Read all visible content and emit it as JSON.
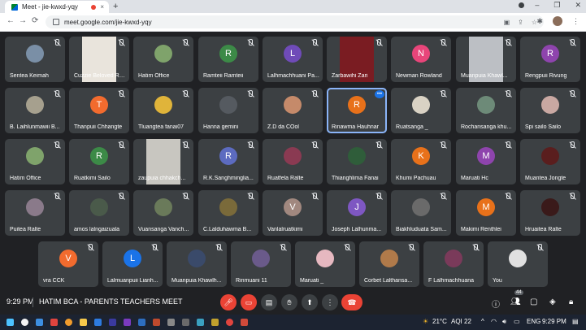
{
  "browser": {
    "tab_title": "Meet - jie-kwxd-yqy",
    "tab_close": "×",
    "new_tab": "+",
    "url": "meet.google.com/jie-kwxd-yqy",
    "back": "←",
    "forward": "→",
    "reload": "⟳",
    "window_buttons": [
      "–",
      "❐",
      "✕"
    ],
    "toolbar_icons": [
      "✱",
      "⋮"
    ]
  },
  "participants": [
    {
      "name": "Sentea Keimah",
      "type": "photo",
      "color": "#7a8fa6"
    },
    {
      "name": "Cuzzie Beloved Ranker",
      "type": "video",
      "color": "#e9e4dc"
    },
    {
      "name": "Hatim Office",
      "type": "photo",
      "color": "#7fa36b"
    },
    {
      "name": "Ramteii Ramteii",
      "type": "initial",
      "initial": "R",
      "color": "#3c8a47"
    },
    {
      "name": "Lalhmachhuani Pa...",
      "type": "initial",
      "initial": "L",
      "color": "#6f4bb8"
    },
    {
      "name": "Zarbawihi Zari",
      "type": "video",
      "color": "#7a1c22"
    },
    {
      "name": "Newman Rowland",
      "type": "initial",
      "initial": "N",
      "color": "#e8457a"
    },
    {
      "name": "Muanpuia Khawl...",
      "type": "video",
      "color": "#bcbfc4"
    },
    {
      "name": "Rengpuii Rivung",
      "type": "initial",
      "initial": "R",
      "color": "#8e44ad"
    },
    {
      "name": "B. Laihlunmawii B...",
      "type": "photo",
      "color": "#a6a08e"
    },
    {
      "name": "Thanpuii Chhangte",
      "type": "initial",
      "initial": "T",
      "color": "#f26b2e"
    },
    {
      "name": "Tluangtea fanai07",
      "type": "photo",
      "color": "#e0b43a"
    },
    {
      "name": "Hanna gemini",
      "type": "photo",
      "color": "#555a60"
    },
    {
      "name": "Z.D da COol",
      "type": "photo",
      "color": "#c58a6a"
    },
    {
      "name": "Rinawma Hauhnar",
      "type": "initial",
      "initial": "R",
      "color": "#e8711a",
      "active": true
    },
    {
      "name": "Ruatsanga _",
      "type": "photo",
      "color": "#d9d2c4"
    },
    {
      "name": "Rochansanga khu...",
      "type": "photo",
      "color": "#6d8a78"
    },
    {
      "name": "Spi sailo Sailo",
      "type": "photo",
      "color": "#c9a8a2"
    },
    {
      "name": "Hatim Office",
      "type": "photo",
      "color": "#7fa36b"
    },
    {
      "name": "Ruatkimi Sailo",
      "type": "initial",
      "initial": "R",
      "color": "#3c8a47"
    },
    {
      "name": "zaupuia chhakch...",
      "type": "video",
      "color": "#c8c6c0"
    },
    {
      "name": "R.K.Sanghminglia...",
      "type": "initial",
      "initial": "R",
      "color": "#5c6bc0"
    },
    {
      "name": "Ruatfela Ralte",
      "type": "photo",
      "color": "#8a3a52"
    },
    {
      "name": "Thianghlima Fanai",
      "type": "photo",
      "color": "#2f5d3a"
    },
    {
      "name": "Khumi Pachuau",
      "type": "initial",
      "initial": "K",
      "color": "#e8711a"
    },
    {
      "name": "Maruati Hc",
      "type": "initial",
      "initial": "M",
      "color": "#8e44ad"
    },
    {
      "name": "Muantea Jongte",
      "type": "photo",
      "color": "#5a1e1e"
    },
    {
      "name": "Puitea Ralte",
      "type": "photo",
      "color": "#8a7a8a"
    },
    {
      "name": "amos lalngaizuala",
      "type": "photo",
      "color": "#4a5a4a"
    },
    {
      "name": "Vuansanga Vanch...",
      "type": "photo",
      "color": "#6a7a5a"
    },
    {
      "name": "C.Lalduhawma B...",
      "type": "photo",
      "color": "#7a6a3a"
    },
    {
      "name": "Vanlalruatkimi",
      "type": "initial",
      "initial": "V",
      "color": "#a1887f"
    },
    {
      "name": "Joseph Lalhunma...",
      "type": "initial",
      "initial": "J",
      "color": "#7e57c2"
    },
    {
      "name": "Biakhluduata Sam...",
      "type": "photo",
      "color": "#6a6a6a"
    },
    {
      "name": "Makimi Renthlei",
      "type": "initial",
      "initial": "M",
      "color": "#e8711a"
    },
    {
      "name": "Hruaitea Ralte",
      "type": "photo",
      "color": "#3a1a1a"
    },
    {
      "name": "vra CCK",
      "type": "initial",
      "initial": "V",
      "color": "#f26b2e"
    },
    {
      "name": "Lalmuanpuii Lianh...",
      "type": "initial",
      "initial": "L",
      "color": "#1a73e8"
    },
    {
      "name": "Muanpuia Khawlh...",
      "type": "photo",
      "color": "#3a4a6a"
    },
    {
      "name": "Rinmuani 11",
      "type": "photo",
      "color": "#6a5a8a"
    },
    {
      "name": "Maruati _",
      "type": "photo",
      "color": "#e6b8c0"
    },
    {
      "name": "Corbet Lalthansa...",
      "type": "photo",
      "color": "#b07a4a"
    },
    {
      "name": "F Lalhmachhuana",
      "type": "photo",
      "color": "#7a3a5a"
    },
    {
      "name": "You",
      "type": "photo",
      "color": "#e0e0e0"
    }
  ],
  "meeting": {
    "time": "9:29 PM",
    "title": "HATIM BCA - PARENTS TEACHERS MEET",
    "participant_count": "44"
  },
  "taskbar": {
    "weather": "21°C",
    "aqi": "AQI 22",
    "language": "ENG",
    "time": "9:29 PM"
  }
}
